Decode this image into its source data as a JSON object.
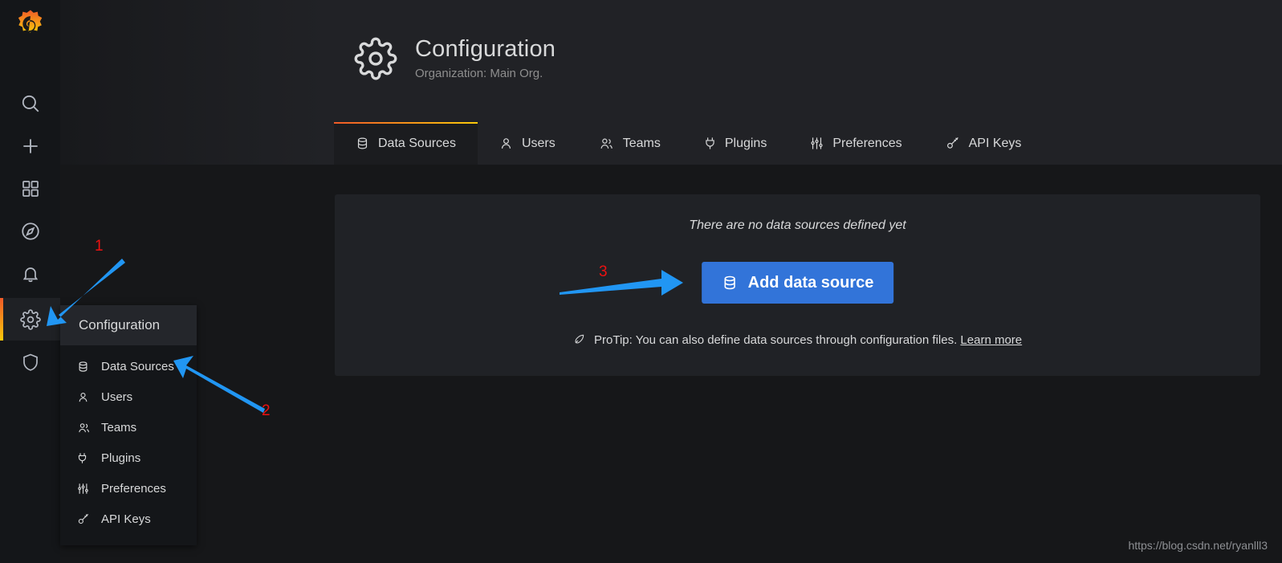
{
  "brand": {
    "logo_icon": "grafana-logo-icon",
    "accent_start": "#f05a28",
    "accent_end": "#fbca0a"
  },
  "sidebar": {
    "items": [
      {
        "icon": "search-icon",
        "name": "search"
      },
      {
        "icon": "plus-icon",
        "name": "create"
      },
      {
        "icon": "dashboards-icon",
        "name": "dashboards"
      },
      {
        "icon": "compass-icon",
        "name": "explore"
      },
      {
        "icon": "bell-icon",
        "name": "alerting"
      },
      {
        "icon": "gear-icon",
        "name": "configuration",
        "active": true
      },
      {
        "icon": "shield-icon",
        "name": "server-admin"
      }
    ]
  },
  "header": {
    "icon": "gear-icon",
    "title": "Configuration",
    "subtitle": "Organization: Main Org."
  },
  "tabs": [
    {
      "label": "Data Sources",
      "icon": "database-icon",
      "active": true
    },
    {
      "label": "Users",
      "icon": "user-icon",
      "active": false
    },
    {
      "label": "Teams",
      "icon": "users-icon",
      "active": false
    },
    {
      "label": "Plugins",
      "icon": "plug-icon",
      "active": false
    },
    {
      "label": "Preferences",
      "icon": "sliders-icon",
      "active": false
    },
    {
      "label": "API Keys",
      "icon": "key-icon",
      "active": false
    }
  ],
  "main": {
    "empty_message": "There are no data sources defined yet",
    "add_button": {
      "label": "Add data source",
      "icon": "database-icon",
      "color": "#3274d9"
    },
    "protip": {
      "icon": "rocket-icon",
      "text": "ProTip: You can also define data sources through configuration files.",
      "link_label": "Learn more"
    }
  },
  "flyout": {
    "title": "Configuration",
    "items": [
      {
        "label": "Data Sources",
        "icon": "database-icon"
      },
      {
        "label": "Users",
        "icon": "user-icon"
      },
      {
        "label": "Teams",
        "icon": "users-icon"
      },
      {
        "label": "Plugins",
        "icon": "plug-icon"
      },
      {
        "label": "Preferences",
        "icon": "sliders-icon"
      },
      {
        "label": "API Keys",
        "icon": "key-icon"
      }
    ]
  },
  "annotations": {
    "color": "#ee1111",
    "arrow_color": "#2196f3",
    "markers": [
      {
        "label": "1",
        "target": "sidebar gear icon"
      },
      {
        "label": "2",
        "target": "flyout Data Sources item"
      },
      {
        "label": "3",
        "target": "Add data source button"
      }
    ]
  },
  "watermark": {
    "text": "https://blog.csdn.net/ryanlll3"
  }
}
